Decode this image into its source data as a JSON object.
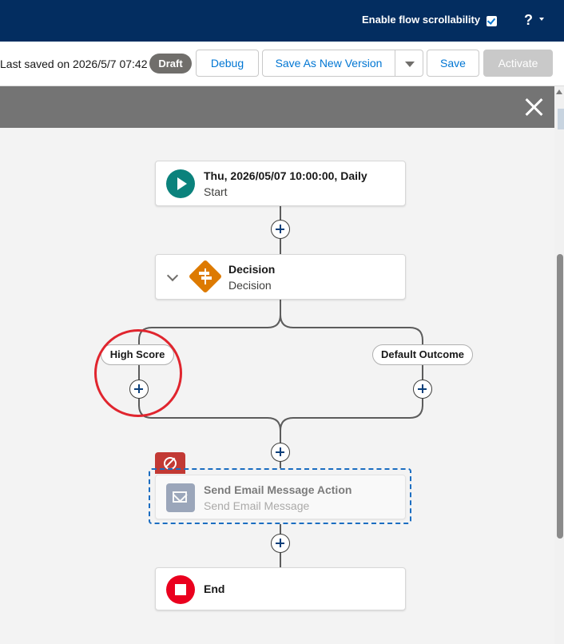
{
  "topbar": {
    "scroll_label": "Enable flow scrollability",
    "scroll_checked": true,
    "help_label": "?"
  },
  "toolbar": {
    "saved_text": "Last saved on 2026/5/7 07:42",
    "status_badge": "Draft",
    "debug_label": "Debug",
    "save_as_new_label": "Save As New Version",
    "save_label": "Save",
    "activate_label": "Activate"
  },
  "flow": {
    "start": {
      "title": "Thu, 2026/05/07 10:00:00, Daily",
      "subtitle": "Start"
    },
    "decision": {
      "title": "Decision",
      "subtitle": "Decision"
    },
    "outcomes": [
      "High Score",
      "Default Outcome"
    ],
    "action": {
      "title": "Send Email Message Action",
      "subtitle": "Send Email Message",
      "disabled": true
    },
    "end": {
      "title": "End"
    }
  },
  "colors": {
    "header_bg": "#032d60",
    "accent": "#0176d3",
    "start_icon": "#0b827c",
    "decision_icon": "#dd7a01",
    "end_icon": "#ea001e",
    "annotation_circle": "#e0252e"
  }
}
